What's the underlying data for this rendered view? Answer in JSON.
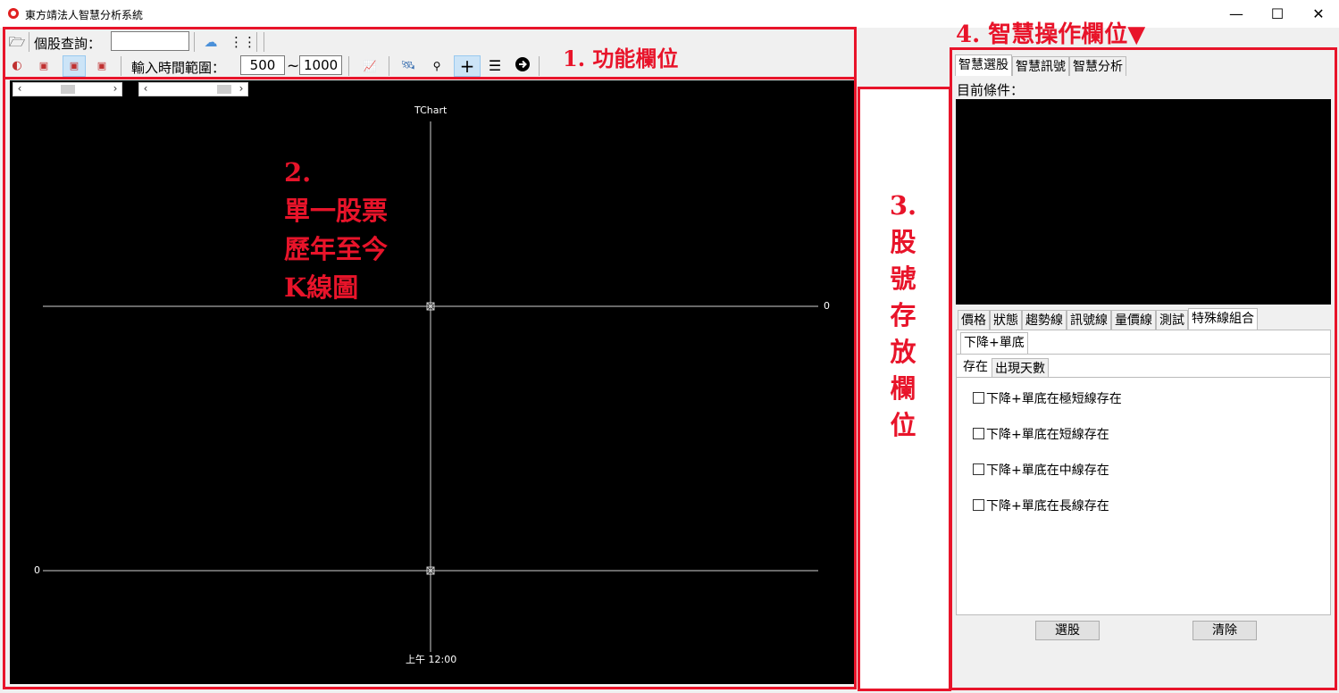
{
  "window": {
    "title": "東方靖法人智慧分析系統",
    "minimize": "—",
    "maximize": "☐",
    "close": "✕"
  },
  "toolbar": {
    "stock_query_label": "個股查詢：",
    "stock_query_value": "",
    "range_label": "輸入時間範圍：",
    "range_from": "500",
    "range_sep": "~",
    "range_to": "1000"
  },
  "chart": {
    "title": "TChart",
    "y_right_label": "0",
    "y_left_label": "0",
    "x_label": "上午 12:00"
  },
  "annotations": {
    "func": "1. 功能欄位",
    "chart_lines": [
      "2.",
      "單一股票",
      "歷年至今",
      "K線圖"
    ],
    "storage": [
      "3.",
      "股",
      "號",
      "存",
      "放",
      "欄",
      "位"
    ],
    "smart": "4. 智慧操作欄位▼"
  },
  "smart_panel": {
    "tabs": [
      "智慧選股",
      "智慧訊號",
      "智慧分析"
    ],
    "current_condition_label": "目前條件：",
    "category_tabs": [
      "價格",
      "狀態",
      "趨勢線",
      "訊號線",
      "量價線",
      "測試",
      "特殊線組合"
    ],
    "subtab": "下降+單底",
    "subsubtabs": [
      "存在",
      "出現天數"
    ],
    "checkboxes": [
      "下降+單底在極短線存在",
      "下降+單底在短線存在",
      "下降+單底在中線存在",
      "下降+單底在長線存在"
    ],
    "select_button": "選股",
    "clear_button": "清除"
  },
  "colors": {
    "annotation_red": "#e8142a",
    "chart_bg": "#000000"
  }
}
